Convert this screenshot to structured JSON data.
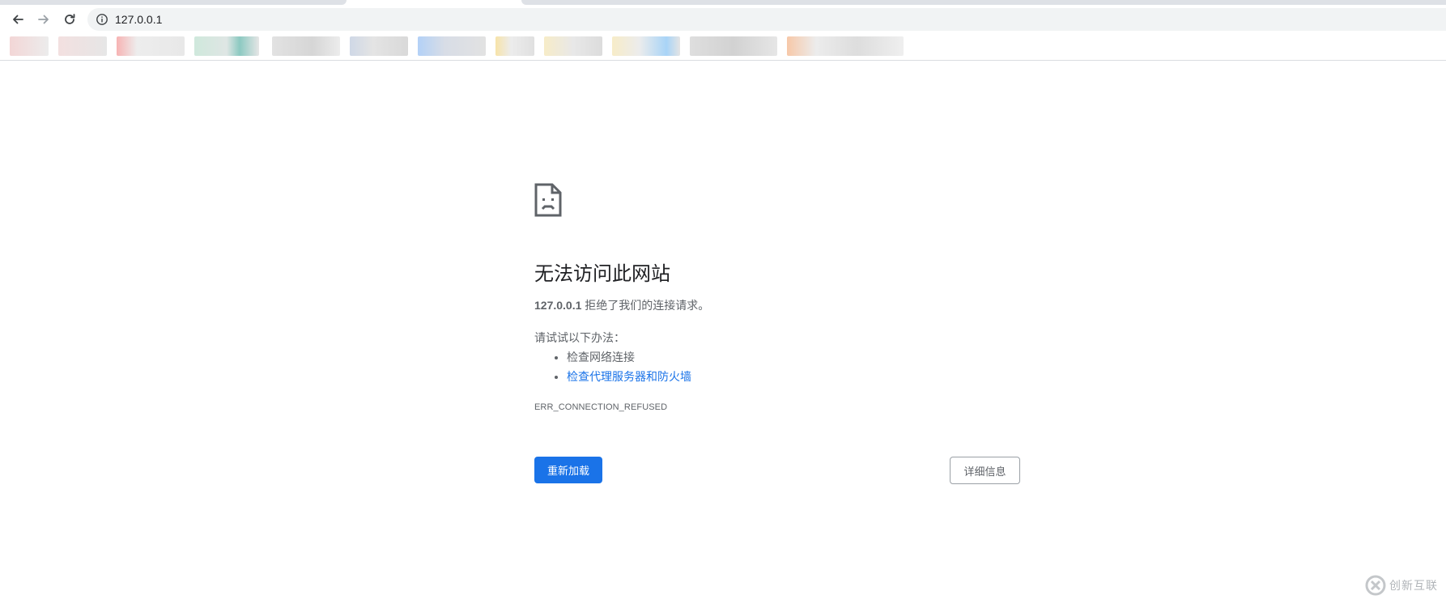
{
  "browser": {
    "url": "127.0.0.1",
    "icons": {
      "back": "arrow-left-icon",
      "forward": "arrow-right-icon",
      "reload": "reload-icon",
      "site_info": "info-circle-icon"
    }
  },
  "bookmarks_bar": {
    "obscured": true,
    "colors": [
      "#f3d6d6",
      "#f7b3b3",
      "#cfe8dc",
      "#8cc9c1",
      "#cfd8e6",
      "#b3d1f7",
      "#f7e3a8",
      "#f7ecc8",
      "#a8d4f7",
      "#f7c8a8"
    ]
  },
  "error_page": {
    "icon": "sad-page-icon",
    "heading": "无法访问此网站",
    "summary_host": "127.0.0.1",
    "summary_text": " 拒绝了我们的连接请求。",
    "suggestions_title": "请试试以下办法：",
    "suggestions": [
      {
        "label": "检查网络连接",
        "link": false
      },
      {
        "label": "检查代理服务器和防火墙",
        "link": true
      }
    ],
    "error_code": "ERR_CONNECTION_REFUSED",
    "reload_button": "重新加载",
    "details_button": "详细信息",
    "colors": {
      "primary": "#1a73e8",
      "text": "#202124",
      "secondary_text": "#5f6368"
    }
  },
  "watermark": {
    "text": "创新互联"
  }
}
